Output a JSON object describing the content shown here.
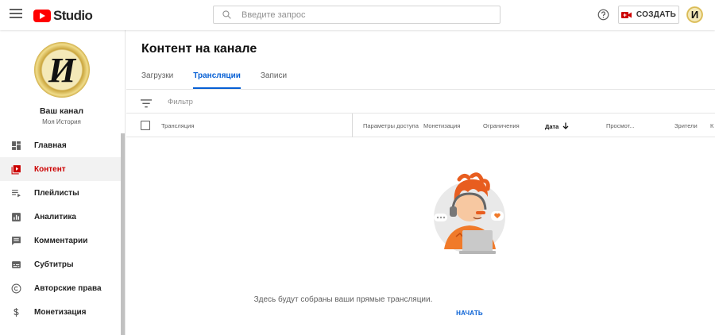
{
  "header": {
    "studio_label": "Studio",
    "search_placeholder": "Введите запрос",
    "create_label": "СОЗДАТЬ",
    "avatar_letter": "И"
  },
  "channel": {
    "avatar_letter": "И",
    "name": "Ваш канал",
    "subtitle": "Моя История"
  },
  "sidebar": {
    "items": [
      {
        "label": "Главная",
        "icon": "dashboard-icon"
      },
      {
        "label": "Контент",
        "icon": "video-library-icon",
        "active": true
      },
      {
        "label": "Плейлисты",
        "icon": "playlist-icon"
      },
      {
        "label": "Аналитика",
        "icon": "analytics-icon"
      },
      {
        "label": "Комментарии",
        "icon": "comments-icon"
      },
      {
        "label": "Субтитры",
        "icon": "subtitles-icon"
      },
      {
        "label": "Авторские права",
        "icon": "copyright-icon"
      },
      {
        "label": "Монетизация",
        "icon": "dollar-icon"
      }
    ]
  },
  "main": {
    "title": "Контент на канале",
    "tabs": [
      {
        "label": "Загрузки"
      },
      {
        "label": "Трансляции",
        "active": true
      },
      {
        "label": "Записи"
      }
    ],
    "filter_placeholder": "Фильтр",
    "columns": {
      "stream": "Трансляция",
      "access": "Параметры доступа",
      "monetization": "Монетизация",
      "restrictions": "Ограничения",
      "date": "Дата",
      "views": "Просмот...",
      "viewers": "Зрители",
      "comments": "К"
    },
    "empty_text": "Здесь будут собраны ваши прямые трансляции.",
    "start_label": "НАЧАТЬ"
  },
  "colors": {
    "accent": "#065fd4",
    "brand": "#ff0000",
    "active_nav": "#cc0000"
  }
}
